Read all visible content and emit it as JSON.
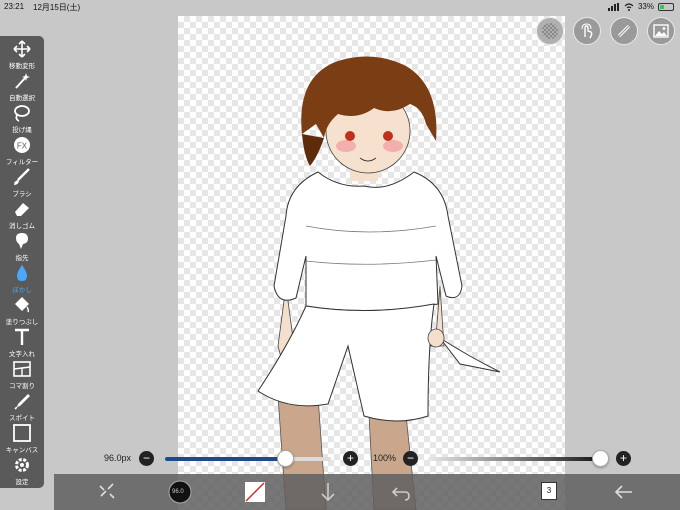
{
  "status_bar": {
    "time": "23:21",
    "date": "12月15日(土)",
    "battery_text": "33%",
    "battery_level": 0.33,
    "icons": [
      "signal-icon",
      "wifi-icon",
      "battery-icon"
    ]
  },
  "toolbar": {
    "items": [
      {
        "label": "移動変形",
        "icon": "move-icon"
      },
      {
        "label": "自動選択",
        "icon": "magic-wand-icon"
      },
      {
        "label": "投げ縄",
        "icon": "lasso-icon"
      },
      {
        "label": "フィルター",
        "icon": "fx-icon"
      },
      {
        "label": "ブラシ",
        "icon": "brush-icon"
      },
      {
        "label": "消しゴム",
        "icon": "eraser-icon"
      },
      {
        "label": "指先",
        "icon": "smudge-icon"
      },
      {
        "label": "ぼかし",
        "icon": "blur-icon",
        "active": true
      },
      {
        "label": "塗りつぶし",
        "icon": "fill-bucket-icon"
      },
      {
        "label": "文字入れ",
        "icon": "text-icon"
      },
      {
        "label": "コマ割り",
        "icon": "frame-divider-icon"
      },
      {
        "label": "スポイト",
        "icon": "eyedropper-icon"
      },
      {
        "label": "キャンバス",
        "icon": "canvas-icon"
      },
      {
        "label": "設定",
        "icon": "gear-icon"
      }
    ]
  },
  "top_buttons": [
    "transparency-toggle-icon",
    "touch-icon",
    "ruler-icon",
    "gallery-icon"
  ],
  "sliders": {
    "brush_size_label": "96.0px",
    "brush_size_fraction": 0.72,
    "opacity_label": "100%",
    "opacity_fraction": 1.0,
    "minus": "−",
    "plus": "+"
  },
  "bottom_bar": {
    "brush_size_preview": "96.0",
    "layer_count": "3",
    "icons": [
      "quick-tools-icon",
      "brush-preview-icon",
      "color-swatch-icon",
      "download-icon",
      "undo-icon",
      "layers-icon",
      "back-arrow-icon"
    ]
  },
  "colors": {
    "accent": "#4aa8ff",
    "toolbar_bg": "#5a5a5a",
    "slider_blue": "#1e4a8a"
  }
}
